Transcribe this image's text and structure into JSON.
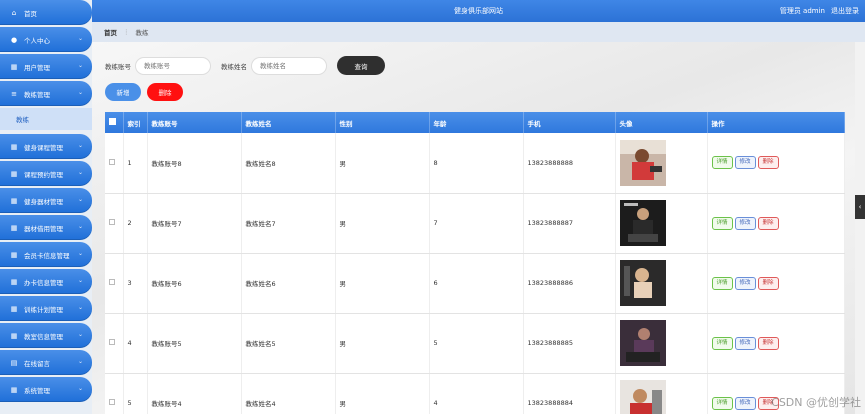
{
  "header": {
    "title": "健身俱乐部网站",
    "user": "管理员 admin",
    "logout": "退出登录"
  },
  "breadcrumb": {
    "home": "首页",
    "sep": "⋮",
    "current": "教练"
  },
  "sidebar": {
    "items": [
      {
        "label": "首页",
        "icon": "home-icon",
        "glyph": "⌂",
        "chev": false
      },
      {
        "label": "个人中心",
        "icon": "user-icon",
        "glyph": "●",
        "chev": true
      },
      {
        "label": "用户管理",
        "icon": "grid-icon",
        "glyph": "▦",
        "chev": true
      },
      {
        "label": "教练管理",
        "icon": "sliders-icon",
        "glyph": "≡",
        "chev": true
      },
      {
        "label": "健身课程管理",
        "icon": "grid-icon",
        "glyph": "▦",
        "chev": true
      },
      {
        "label": "课程预约管理",
        "icon": "grid-icon",
        "glyph": "▦",
        "chev": true
      },
      {
        "label": "健身器材管理",
        "icon": "grid-icon",
        "glyph": "▦",
        "chev": true
      },
      {
        "label": "器材借用管理",
        "icon": "grid-icon",
        "glyph": "▦",
        "chev": true
      },
      {
        "label": "会员卡信息管理",
        "icon": "grid-icon",
        "glyph": "▦",
        "chev": true
      },
      {
        "label": "办卡信息管理",
        "icon": "grid-icon",
        "glyph": "▦",
        "chev": true
      },
      {
        "label": "训练计划管理",
        "icon": "grid-icon",
        "glyph": "▦",
        "chev": true
      },
      {
        "label": "教室信息管理",
        "icon": "grid-icon",
        "glyph": "▦",
        "chev": true
      },
      {
        "label": "在线留言",
        "icon": "message-icon",
        "glyph": "▤",
        "chev": true
      },
      {
        "label": "系统管理",
        "icon": "grid-icon",
        "glyph": "▦",
        "chev": true
      }
    ],
    "sub_item": "教练"
  },
  "search": {
    "label1": "教练账号",
    "placeholder1": "教练账号",
    "label2": "教练姓名",
    "placeholder2": "教练姓名",
    "query": "查询"
  },
  "actions": {
    "add": "新增",
    "delete": "删除"
  },
  "table": {
    "headers": [
      "",
      "索引",
      "教练账号",
      "教练姓名",
      "性别",
      "年龄",
      "手机",
      "头像",
      "操作"
    ],
    "ops": {
      "detail": "详情",
      "edit": "修改",
      "del": "删除"
    },
    "rows": [
      {
        "idx": "1",
        "account": "教练账号8",
        "name": "教练姓名8",
        "gender": "男",
        "age": "8",
        "phone": "13823888888"
      },
      {
        "idx": "2",
        "account": "教练账号7",
        "name": "教练姓名7",
        "gender": "男",
        "age": "7",
        "phone": "13823888887"
      },
      {
        "idx": "3",
        "account": "教练账号6",
        "name": "教练姓名6",
        "gender": "男",
        "age": "6",
        "phone": "13823888886"
      },
      {
        "idx": "4",
        "account": "教练账号5",
        "name": "教练姓名5",
        "gender": "男",
        "age": "5",
        "phone": "13823888885"
      },
      {
        "idx": "5",
        "account": "教练账号4",
        "name": "教练姓名4",
        "gender": "男",
        "age": "4",
        "phone": "13823888884"
      }
    ]
  },
  "watermark": "CSDN @优创学社"
}
